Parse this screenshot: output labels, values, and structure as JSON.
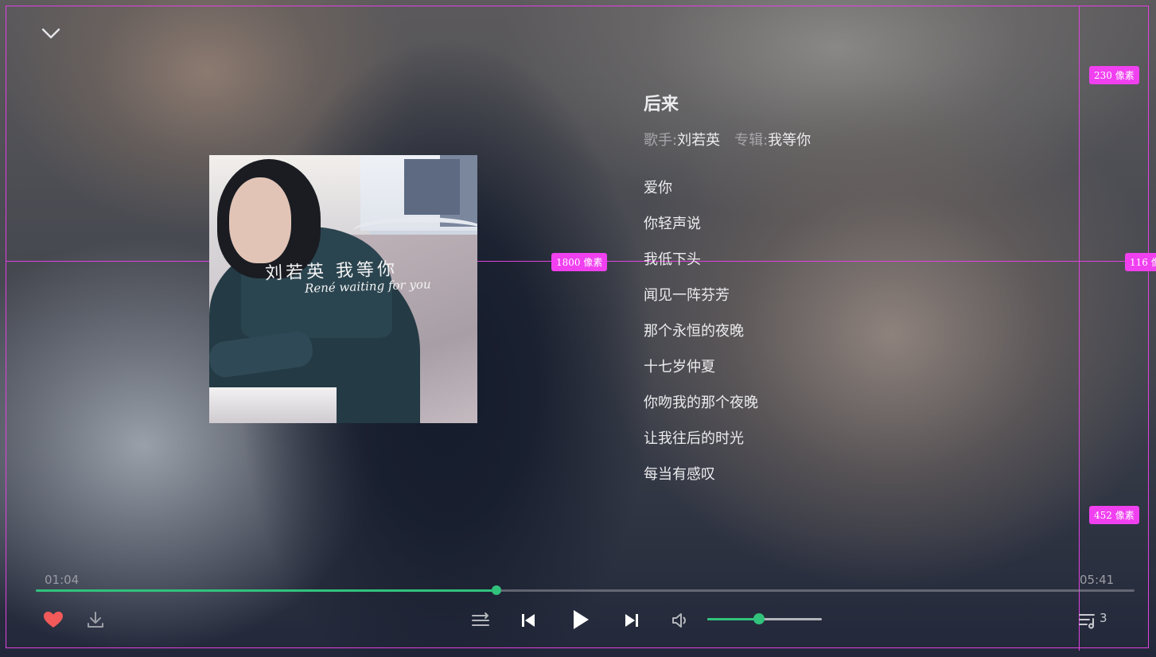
{
  "song": {
    "title": "后来",
    "artist_label": "歌手:",
    "artist": "刘若英",
    "album_label": "专辑:",
    "album": "我等你"
  },
  "cover": {
    "alt": "我等你 album cover",
    "script_cn": "刘若英 我等你",
    "script_en": "René waiting for you"
  },
  "lyrics": [
    "爱你",
    "你轻声说",
    "我低下头",
    "闻见一阵芬芳",
    "那个永恒的夜晚",
    "十七岁仲夏",
    "你吻我的那个夜晚",
    "让我往后的时光",
    "每当有感叹"
  ],
  "player": {
    "current_time": "01:04",
    "total_time": "05:41",
    "progress_fraction": 0.419,
    "volume_fraction": 0.45,
    "queue_count": "3",
    "liked": true,
    "accent_color": "#31c27c",
    "like_color": "#f25a5a"
  },
  "icons": {
    "collapse": "chevron-down-icon",
    "like": "heart-icon",
    "download": "download-icon",
    "play_mode": "playlist-order-icon",
    "prev": "skip-previous-icon",
    "play": "play-icon",
    "next": "skip-next-icon",
    "volume": "volume-icon",
    "queue": "playlist-queue-icon"
  },
  "annotations": {
    "width_tag": "1800 像素",
    "top_tag": "230 像素",
    "mid_tag": "116 像素",
    "bottom_tag": "452 像素"
  }
}
